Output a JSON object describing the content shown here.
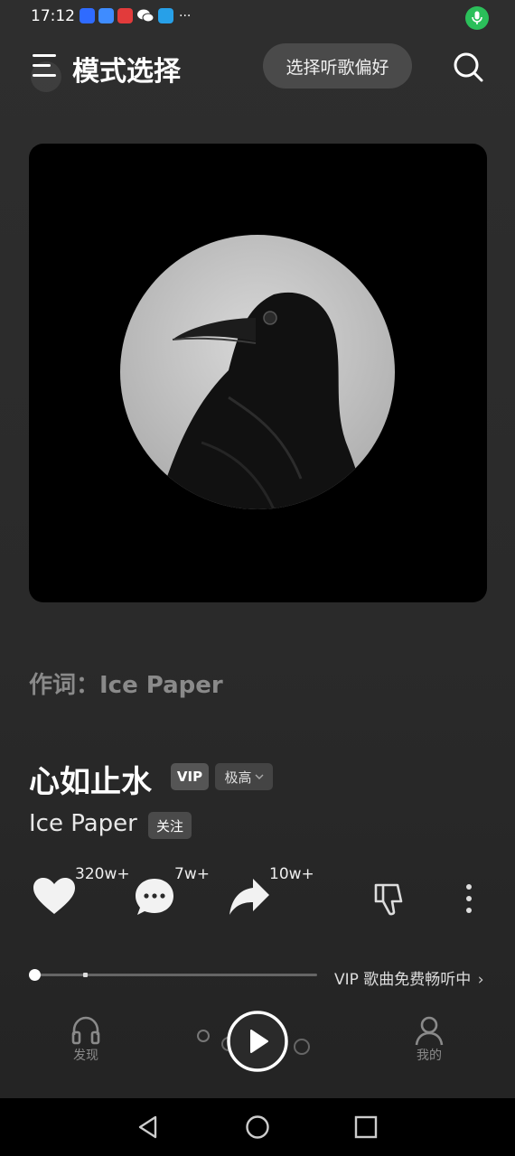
{
  "status_bar": {
    "time": "17:12",
    "more": "···",
    "app_icon_colors": [
      "#2f6bff",
      "#3f8cff",
      "#e23b3b",
      "#ffffff",
      "#27a0e8"
    ]
  },
  "header": {
    "title": "模式选择",
    "preference_button": "选择听歌偏好"
  },
  "lyricist": "作词：Ice Paper",
  "song": {
    "title": "心如止水",
    "vip_badge": "VIP",
    "quality": "极高",
    "artist": "Ice Paper",
    "follow": "关注"
  },
  "actions": {
    "likes": "320w+",
    "comments": "7w+",
    "shares": "10w+"
  },
  "progress": {
    "fraction": 0.0,
    "vip_free_text": "VIP 歌曲免费畅听中"
  },
  "bottom_nav": {
    "discover": "发现",
    "mine": "我的"
  },
  "colors": {
    "accent_mic": "#2bbf5a",
    "background": "#2b2b2b"
  }
}
